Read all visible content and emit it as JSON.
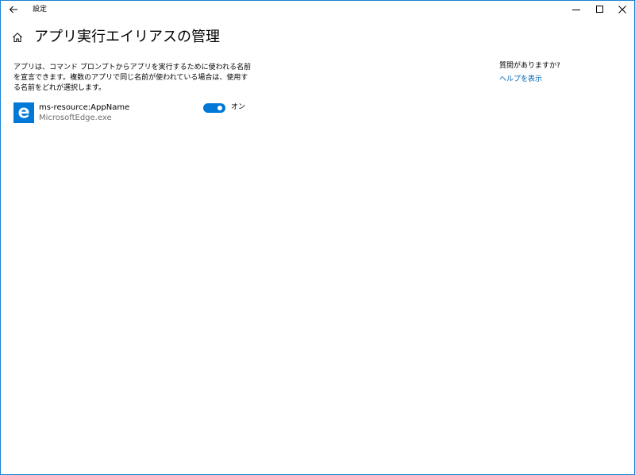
{
  "window": {
    "title": "設定",
    "accent_color": "#0078d7",
    "border_color": "#1883d7"
  },
  "header": {
    "title": "アプリ実行エイリアスの管理"
  },
  "main": {
    "description": "アプリは、コマンド プロンプトからアプリを実行するために使われる名前を宣言できます。複数のアプリで同じ名前が使われている場合は、使用する名前をどれが選択します。",
    "aliases": [
      {
        "name": "ms-resource:AppName",
        "executable": "MicrosoftEdge.exe",
        "icon": "edge-icon",
        "toggle_state": "on",
        "toggle_label": "オン"
      }
    ]
  },
  "help": {
    "title": "質問がありますか?",
    "link": "ヘルプを表示",
    "link_color": "#0063b1"
  }
}
